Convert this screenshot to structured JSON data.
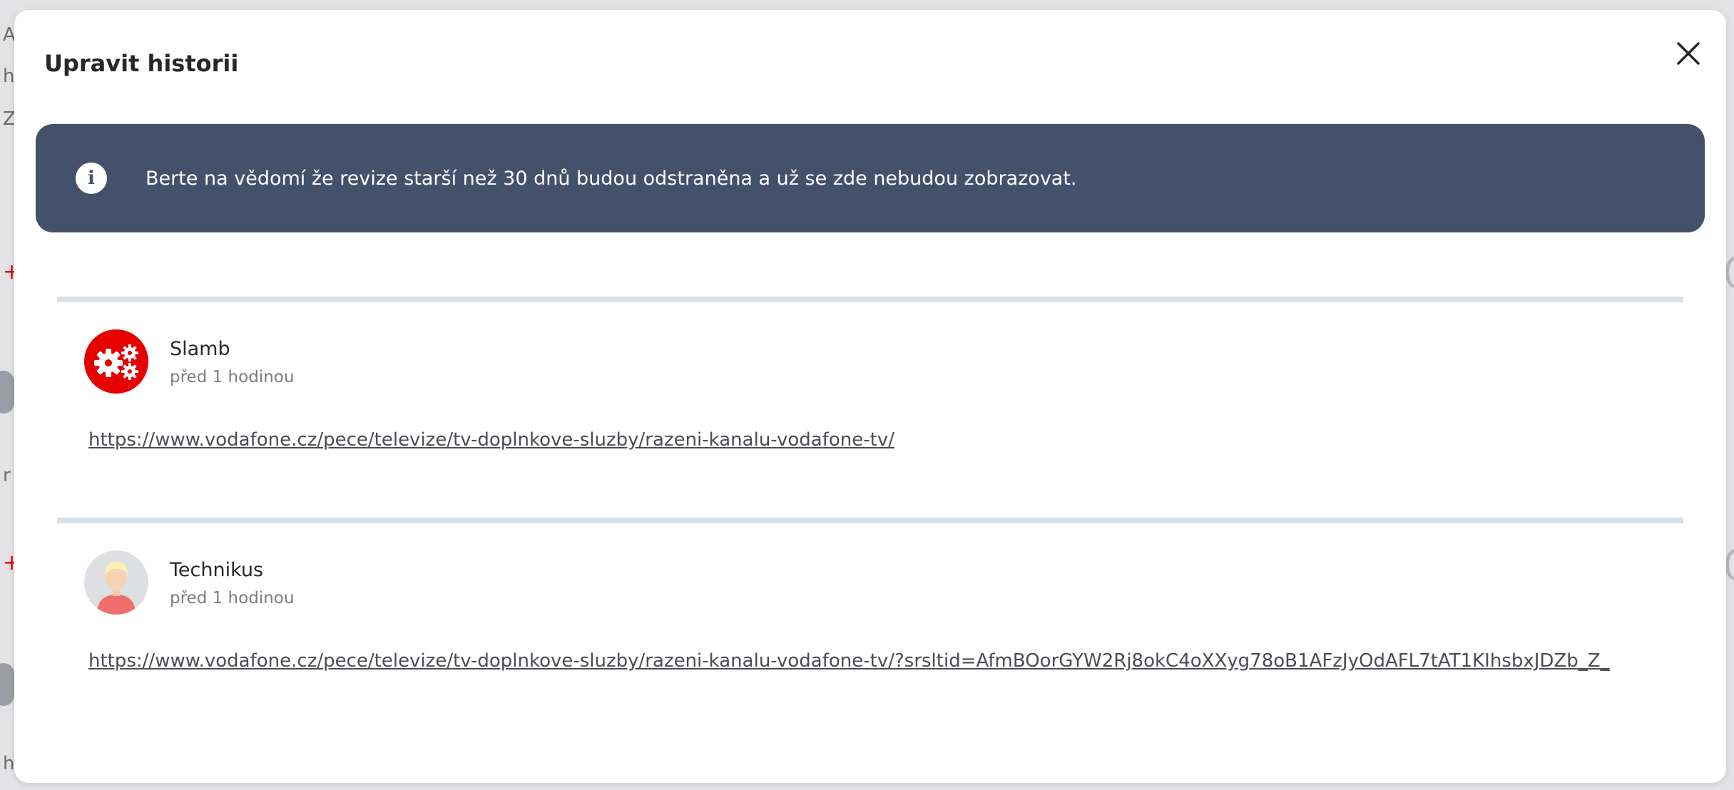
{
  "modal": {
    "title": "Upravit historii",
    "close_icon": "close-icon"
  },
  "banner": {
    "icon": "info-icon",
    "icon_glyph": "i",
    "text": "Berte na vědomí že revize starší než 30 dnů budou odstraněna a už se zde nebudou zobrazovat."
  },
  "entries": [
    {
      "author": "Slamb",
      "time": "před 1 hodinou",
      "avatar": "gears-avatar-icon",
      "link": "https://www.vodafone.cz/pece/televize/tv-doplnkove-sluzby/razeni-kanalu-vodafone-tv/"
    },
    {
      "author": "Technikus",
      "time": "před 1 hodinou",
      "avatar": "user-avatar-icon",
      "link": "https://www.vodafone.cz/pece/televize/tv-doplnkove-sluzby/razeni-kanalu-vodafone-tv/?srsltid=AfmBOorGYW2Rj8okC4oXXyg78oB1AFzJyOdAFL7tAT1KIhsbxJDZb_Z_"
    }
  ],
  "colors": {
    "banner_bg": "#44516b",
    "brand_red": "#e60000",
    "divider": "#d8dfe9"
  }
}
